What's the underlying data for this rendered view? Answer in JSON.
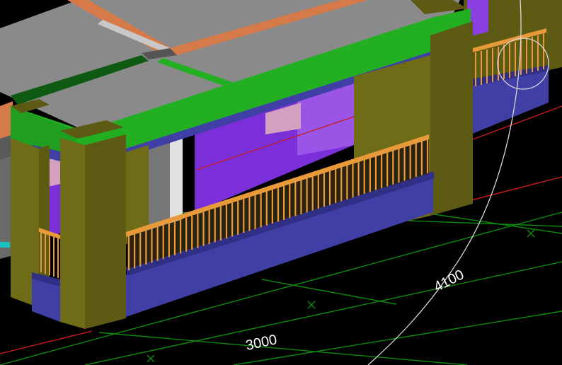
{
  "viewport": {
    "background": "#000000",
    "dimensions": [
      "3000",
      "4100"
    ]
  },
  "colors": {
    "slab_top": "#8a8a8a",
    "beam_green": "#22b022",
    "beam_dark_green": "#0f5a12",
    "beam_orange": "#d77a4a",
    "column_olive": "#5d5a14",
    "column_olive_light": "#6f6c18",
    "parapet_blue": "#3f3fa6",
    "parapet_blue_dark": "#2f2f86",
    "railing_orange": "#e89a3a",
    "wall_purple": "#7a2fd8",
    "wall_purple_light": "#9a55e6",
    "grid_green": "#0e8a0e",
    "axis_red": "#c81c1c",
    "cursor_circle": "#d8d8d8",
    "dimension_text": "#ffffff"
  },
  "icons": [
    "orbit-cursor-icon"
  ]
}
